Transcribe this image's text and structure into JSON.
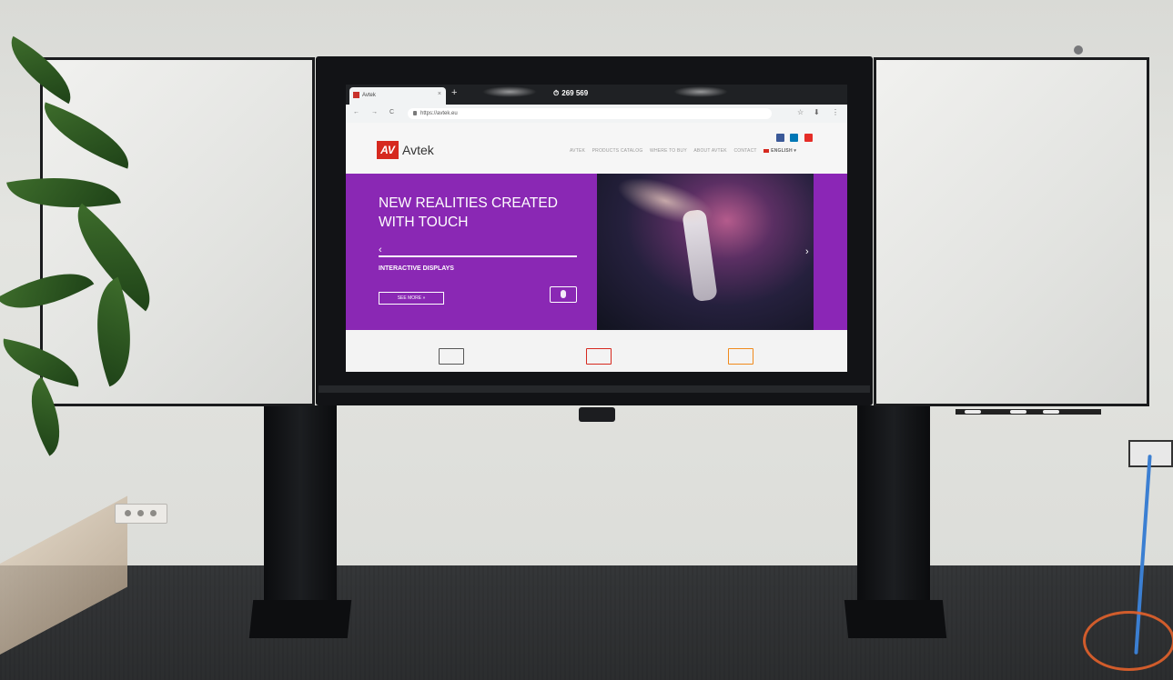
{
  "browser": {
    "tab_label": "Avtek",
    "close_glyph": "×",
    "new_tab_glyph": "+",
    "counter_icon": "clock-icon",
    "counter_value": "269 569",
    "url": "https://avtek.eu",
    "nav_back": "←",
    "nav_forward": "→",
    "nav_reload": "C",
    "star_icon": "☆",
    "download_icon": "⬇",
    "menu_icon": "⋮"
  },
  "site": {
    "logo_mark": "AV",
    "logo_text": "Avtek",
    "nav": [
      "AVTEK",
      "PRODUCTS CATALOG",
      "WHERE TO BUY",
      "ABOUT AVTEK",
      "CONTACT"
    ],
    "language": "ENGLISH ▾",
    "social": [
      {
        "name": "facebook-icon",
        "color": "#3b5998"
      },
      {
        "name": "linkedin-icon",
        "color": "#0077b5"
      },
      {
        "name": "youtube-icon",
        "color": "#e52d27"
      }
    ],
    "hero": {
      "title": "NEW REALITIES CREATED WITH TOUCH",
      "subtitle": "INTERACTIVE DISPLAYS",
      "button": "SEE MORE »",
      "prev": "‹",
      "next": "›",
      "accent": "#8a28b4"
    },
    "cards": [
      {
        "name": "card-display-icon",
        "color": "#555555"
      },
      {
        "name": "card-box-icon",
        "color": "#d6291f"
      },
      {
        "name": "card-window-icon",
        "color": "#f08a1c"
      }
    ]
  }
}
